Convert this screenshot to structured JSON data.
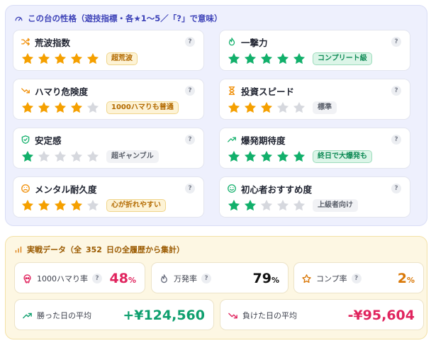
{
  "traits_panel": {
    "title": "この台の性格（遊技指標・各★1〜5／「?」で意味）",
    "help_label": "?",
    "items": [
      {
        "label": "荒波指数",
        "icon": "shuffle-icon",
        "icon_color": "#f08c00",
        "rating": 5,
        "max": 5,
        "star_color": "#f5a000",
        "chip": "超荒波",
        "chip_style": "orange"
      },
      {
        "label": "一撃力",
        "icon": "flame-icon",
        "icon_color": "#12b06b",
        "rating": 5,
        "max": 5,
        "star_color": "#12b06b",
        "chip": "コンプリート級",
        "chip_style": "green"
      },
      {
        "label": "ハマり危険度",
        "icon": "trending-down-icon",
        "icon_color": "#f08c00",
        "rating": 4,
        "max": 5,
        "star_color": "#f5a000",
        "chip": "1000ハマりも普通",
        "chip_style": "orange"
      },
      {
        "label": "投資スピード",
        "icon": "hourglass-icon",
        "icon_color": "#f08c00",
        "rating": 3,
        "max": 5,
        "star_color": "#f5a000",
        "chip": "標準",
        "chip_style": "gray"
      },
      {
        "label": "安定感",
        "icon": "shield-check-icon",
        "icon_color": "#12b06b",
        "rating": 1,
        "max": 5,
        "star_color": "#12b06b",
        "chip": "超ギャンブル",
        "chip_style": "gray"
      },
      {
        "label": "爆発期待度",
        "icon": "trending-up-icon",
        "icon_color": "#12b06b",
        "rating": 5,
        "max": 5,
        "star_color": "#12b06b",
        "chip": "終日で大爆発も",
        "chip_style": "green"
      },
      {
        "label": "メンタル耐久度",
        "icon": "frown-icon",
        "icon_color": "#f08c00",
        "rating": 4,
        "max": 5,
        "star_color": "#f5a000",
        "chip": "心が折れやすい",
        "chip_style": "orange"
      },
      {
        "label": "初心者おすすめ度",
        "icon": "smile-icon",
        "icon_color": "#12b06b",
        "rating": 2,
        "max": 5,
        "star_color": "#12b06b",
        "chip": "上級者向け",
        "chip_style": "gray"
      }
    ]
  },
  "stats_panel": {
    "title_prefix": "実戦データ（全",
    "title_days": "352",
    "title_suffix": "日の全履歴から集計）",
    "cards": [
      {
        "label": "1000ハマり率",
        "icon": "skull-icon",
        "value": "48",
        "unit": "%",
        "value_color": "#e0245e",
        "has_help": true
      },
      {
        "label": "万発率",
        "icon": "flame-outline-icon",
        "value": "79",
        "unit": "%",
        "value_color": "#111111",
        "has_help": true
      },
      {
        "label": "コンプ率",
        "icon": "star-outline-icon",
        "value": "2",
        "unit": "%",
        "value_color": "#d97706",
        "has_help": true
      },
      {
        "label": "勝った日の平均",
        "icon": "trending-up-icon",
        "value": "+¥124,560",
        "unit": "",
        "value_color": "#0e9f6e",
        "has_help": false
      },
      {
        "label": "負けた日の平均",
        "icon": "trending-down-icon",
        "value": "-¥95,604",
        "unit": "",
        "value_color": "#e0245e",
        "has_help": false
      }
    ]
  },
  "colors": {
    "accent_purple": "#3d42b8",
    "star_empty": "#d6d8de",
    "warn_orange": "#f08c00",
    "good_green": "#12b06b",
    "bad_red": "#e0245e"
  }
}
